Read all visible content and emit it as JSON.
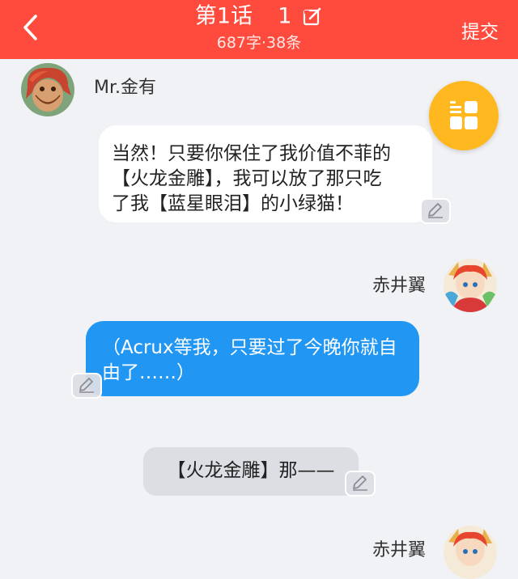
{
  "header": {
    "title": "第1话",
    "chapter_number": "1",
    "stats": "687字·38条",
    "submit_label": "提交",
    "background_color": "#ff4b3e"
  },
  "messages": [
    {
      "sender": "Mr.金有",
      "side": "left",
      "style": "white",
      "lines": [
        "当然！只要你保住了我价值不菲的",
        "【火龙金雕】，我可以放了那只吃",
        "了我【蓝星眼泪】的小绿猫！"
      ]
    },
    {
      "sender": "赤井翼",
      "side": "right",
      "style": "blue",
      "lines": [
        "（Acrux等我，只要过了今晚你就自",
        "由了……）"
      ]
    },
    {
      "sender": "",
      "side": "center",
      "style": "gray",
      "lines": [
        "【火龙金雕】那——"
      ]
    },
    {
      "sender": "赤井翼",
      "side": "right",
      "style": "blue",
      "lines": []
    }
  ],
  "icons": {
    "back": "chevron-left-icon",
    "edit_title": "edit-square-icon",
    "edit_message": "pencil-icon",
    "float_menu": "grid-menu-icon"
  },
  "colors": {
    "page_bg": "#f1f2f6",
    "blue_bubble": "#2196f3",
    "float_button": "#ffb81f"
  }
}
